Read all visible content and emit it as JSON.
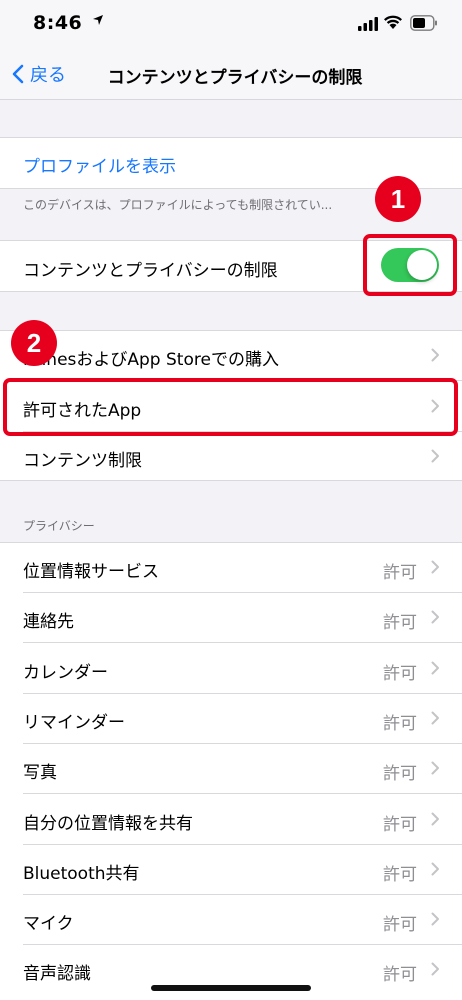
{
  "status_bar": {
    "time": "8:46"
  },
  "nav": {
    "back_label": "戻る",
    "title": "コンテンツとプライバシーの制限"
  },
  "profile": {
    "link": "プロファイルを表示",
    "note": "このデバイスは、プロファイルによっても制限されてい..."
  },
  "restriction": {
    "label": "コンテンツとプライバシーの制限",
    "enabled": true,
    "accent": "#34c759"
  },
  "group1": [
    {
      "label": "iTunesおよびApp Storeでの購入"
    },
    {
      "label": "許可されたApp"
    },
    {
      "label": "コンテンツ制限"
    }
  ],
  "privacy": {
    "header": "プライバシー",
    "items": [
      {
        "label": "位置情報サービス",
        "value": "許可"
      },
      {
        "label": "連絡先",
        "value": "許可"
      },
      {
        "label": "カレンダー",
        "value": "許可"
      },
      {
        "label": "リマインダー",
        "value": "許可"
      },
      {
        "label": "写真",
        "value": "許可"
      },
      {
        "label": "自分の位置情報を共有",
        "value": "許可"
      },
      {
        "label": "Bluetooth共有",
        "value": "許可"
      },
      {
        "label": "マイク",
        "value": "許可"
      },
      {
        "label": "音声認識",
        "value": "許可"
      }
    ]
  },
  "annotations": {
    "badge1": "1",
    "badge2": "2",
    "color": "#e6001e"
  }
}
